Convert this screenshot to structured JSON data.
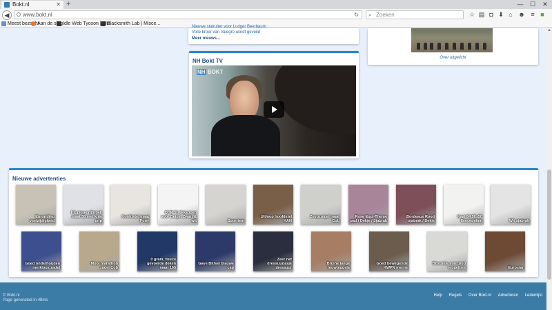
{
  "browser": {
    "tab_title": "Bokt.nl",
    "url": "www.bokt.nl",
    "search_placeholder": "Zoeken",
    "bookmarks": [
      "Meest bezocht",
      "Aan de slag",
      "Idle Web Tycoon | Mis...",
      "Blacksmith Lab | Misce..."
    ]
  },
  "news": {
    "items": [
      "Nieuwe stalruiter voor Ludger Beerbaum",
      "Volle broer van Valegro wordt geveild"
    ],
    "more": "Meer nieuws..."
  },
  "uitgelicht": {
    "link": "Over uitgelicht"
  },
  "tv": {
    "title": "NH Bokt TV",
    "logo_nh": "NH",
    "logo_bokt": "BOKT"
  },
  "ads": {
    "title": "Nieuwe advertenties",
    "items": [
      {
        "caption": "Euroriding veelzijdigheid",
        "color": "#c8c2b6"
      },
      {
        "caption": "Hippique rijbroek maat 38 met knie grip",
        "color": "#dfe1e6"
      },
      {
        "caption": "Hoofdstel maat Pony",
        "color": "#e8e5e0"
      },
      {
        "caption": "QHP Strijkkappen voor Beige, Zwart & wit",
        "color": "#f4f4f4"
      },
      {
        "caption": "Sporriem",
        "color": "#d6d4d0"
      },
      {
        "caption": "Uitloop hoofdstel KAN",
        "color": "#7a5f48"
      },
      {
        "caption": "Zeepzuigel maat Cob",
        "color": "#cfcfcc"
      },
      {
        "caption": "Rose Equi-Theme pad / Dekje / Sjabrak",
        "color": "#a9859a"
      },
      {
        "caption": "Bordeaux Rood sjabrak / Dekje",
        "color": "#7e4f58"
      },
      {
        "caption": "Kaal 64 50x50 fleecedeken",
        "color": "#f2f2f0"
      },
      {
        "caption": "Wit sjabrak",
        "color": "#e4e4e4"
      },
      {
        "caption": "Goed onderhouden merkloos zadel",
        "color": "#3d4f8f"
      },
      {
        "caption": "Mooi marathon zadel Cob",
        "color": "#b9a98c"
      },
      {
        "caption": "0 gram, fleece gevoerde deken maat 165",
        "color": "#223866"
      },
      {
        "caption": "Gave Bit/sel blauwe cap",
        "color": "#2c3a6a"
      },
      {
        "caption": "Zeer net dressuurjasje dressuur",
        "color": "#2a2e3e"
      },
      {
        "caption": "Bruine lange touwteugels",
        "color": "#a77d64"
      },
      {
        "caption": "Goed bewegende KWPN merrie",
        "color": "#6b5c4e"
      },
      {
        "caption": "Bitstukje voor bob teugeltjes",
        "color": "#d9d9d6"
      },
      {
        "caption": "Eurostar",
        "color": "#6c4a34"
      }
    ]
  },
  "footer": {
    "copyright": "© Bokt.nl",
    "generated": "Page generated in 48ms",
    "links": [
      "Help",
      "Regels",
      "Over Bokt.nl",
      "Adverteren",
      "Ledenlijst"
    ]
  }
}
